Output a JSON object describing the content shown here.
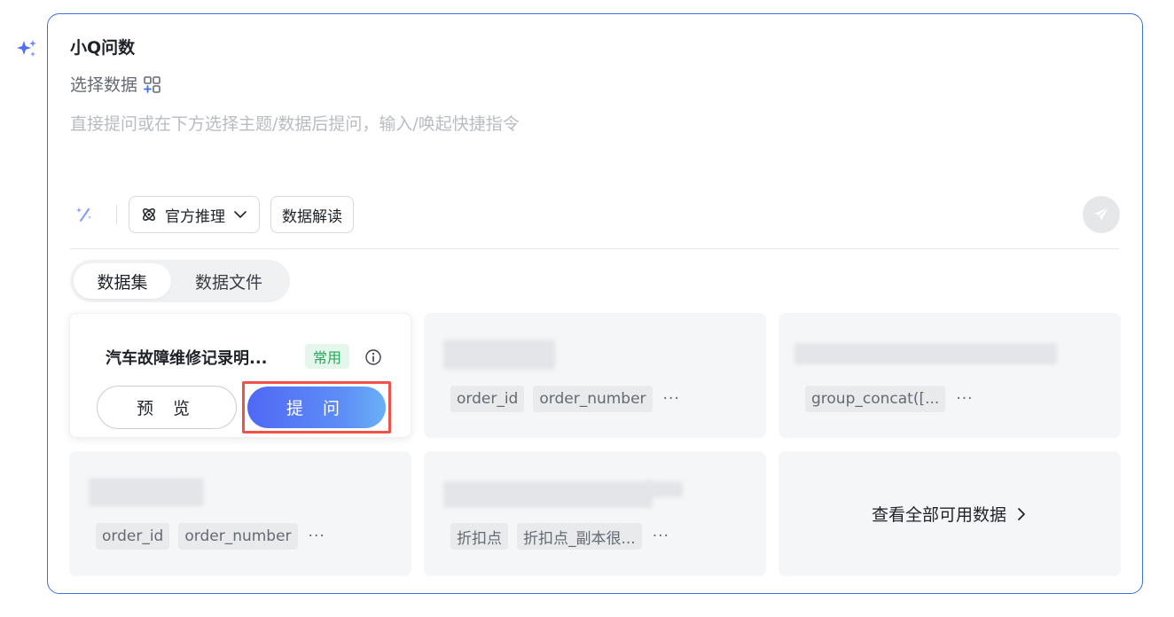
{
  "header": {
    "title": "小Q问数",
    "select_data_label": "选择数据",
    "prompt_placeholder": "直接提问或在下方选择主题/数据后提问，输入/唤起快捷指令"
  },
  "toolbar": {
    "model_label": "官方推理",
    "interpret_label": "数据解读"
  },
  "tabs": [
    {
      "label": "数据集",
      "active": true
    },
    {
      "label": "数据文件",
      "active": false
    }
  ],
  "cards": [
    {
      "title": "汽车故障维修记录明...",
      "badge": "常用",
      "preview_label": "预 览",
      "ask_label": "提 问"
    },
    {
      "fields": [
        "order_id",
        "order_number"
      ],
      "more": "···"
    },
    {
      "fields": [
        "group_concat([..."
      ],
      "more": "···"
    },
    {
      "fields": [
        "order_id",
        "order_number"
      ],
      "more": "···"
    },
    {
      "fields": [
        "折扣点",
        "折扣点_副本很..."
      ],
      "more": "···"
    }
  ],
  "view_all_label": "查看全部可用数据",
  "colors": {
    "accent": "#3d6fe0",
    "ask_gradient_start": "#5068f5",
    "ask_gradient_end": "#6ab0f7",
    "badge_text": "#26a65b",
    "badge_bg": "#e5f7ec",
    "highlight": "#f0524a"
  },
  "icons": {
    "left_sparkle": "sparkle-icon",
    "select_data": "add-grid-icon",
    "wand": "magic-wand-icon",
    "model": "atom-icon",
    "dropdown": "chevron-down-icon",
    "send": "send-icon",
    "info": "info-icon",
    "view_all": "chevron-right-icon"
  }
}
